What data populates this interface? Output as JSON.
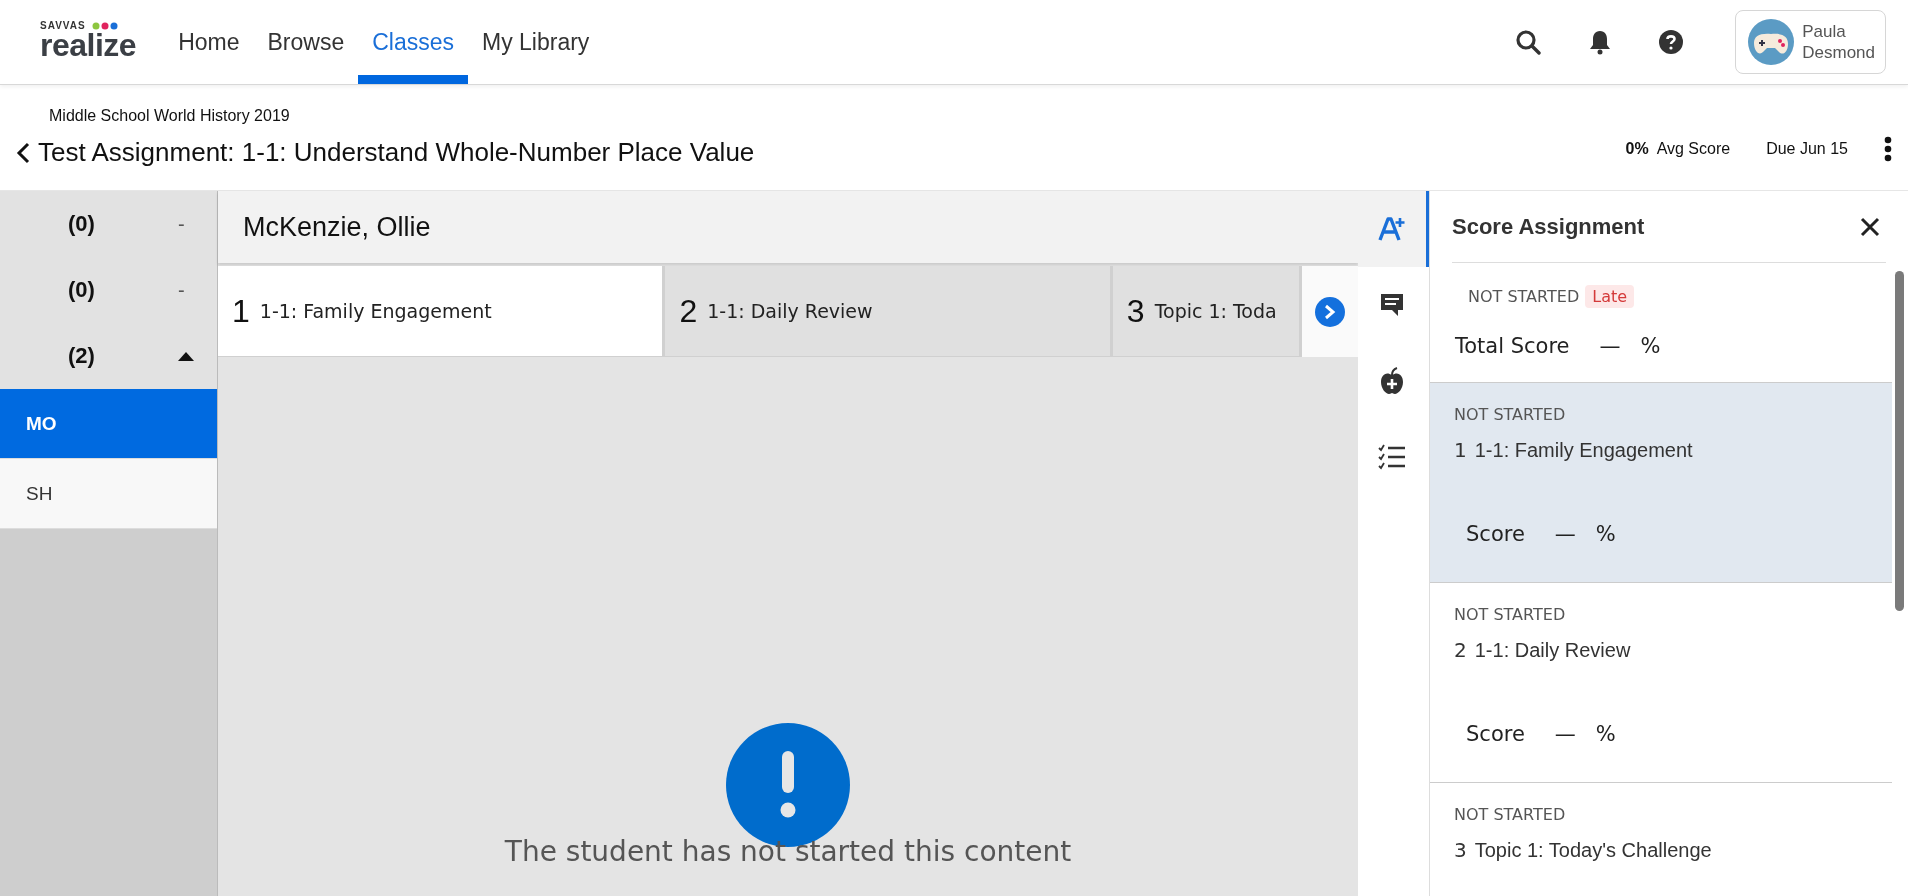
{
  "header": {
    "logo": {
      "brand": "SAVVAS",
      "name": "realize"
    },
    "nav": [
      {
        "label": "Home",
        "selected": false
      },
      {
        "label": "Browse",
        "selected": false
      },
      {
        "label": "Classes",
        "selected": true
      },
      {
        "label": "My Library",
        "selected": false
      }
    ],
    "user": {
      "first": "Paula",
      "last": "Desmond"
    }
  },
  "assignment": {
    "course": "Middle School World History 2019",
    "title": "Test Assignment: 1-1: Understand Whole-Number Place Value",
    "avg_score": "0%",
    "avg_label": "Avg Score",
    "due": "Due Jun 15"
  },
  "groups": [
    {
      "count": "(0)",
      "kind": "dash",
      "mark": "-"
    },
    {
      "count": "(0)",
      "kind": "dash",
      "mark": "-"
    },
    {
      "count": "(2)",
      "kind": "toggle",
      "expanded": true
    }
  ],
  "students": [
    {
      "initials": "MO",
      "selected": true
    },
    {
      "initials": "SH",
      "selected": false
    }
  ],
  "student_name": "McKenzie, Ollie",
  "content_tabs": [
    {
      "number": "1",
      "title": "1-1: Family Engagement",
      "selected": true
    },
    {
      "number": "2",
      "title": "1-1: Daily Review",
      "selected": false
    },
    {
      "number": "3",
      "title": "Topic 1: Toda",
      "selected": false
    }
  ],
  "message": "The student has not started this content",
  "rail": [
    {
      "kind": "score",
      "selected": true
    },
    {
      "kind": "comment",
      "selected": false
    },
    {
      "kind": "apple",
      "selected": false
    },
    {
      "kind": "checklist",
      "selected": false
    }
  ],
  "score_panel": {
    "title": "Score Assignment",
    "status": "NOT STARTED",
    "badge": "Late",
    "total_label": "Total Score",
    "total_value": "—",
    "unit": "%",
    "items": [
      {
        "status": "NOT STARTED",
        "number": "1",
        "title": "1-1: Family Engagement",
        "score_label": "Score",
        "score_value": "—",
        "unit": "%",
        "selected": true
      },
      {
        "status": "NOT STARTED",
        "number": "2",
        "title": "1-1: Daily Review",
        "score_label": "Score",
        "score_value": "—",
        "unit": "%",
        "selected": false
      },
      {
        "status": "NOT STARTED",
        "number": "3",
        "title": "Topic 1: Today's Challenge",
        "selected": false
      }
    ]
  }
}
